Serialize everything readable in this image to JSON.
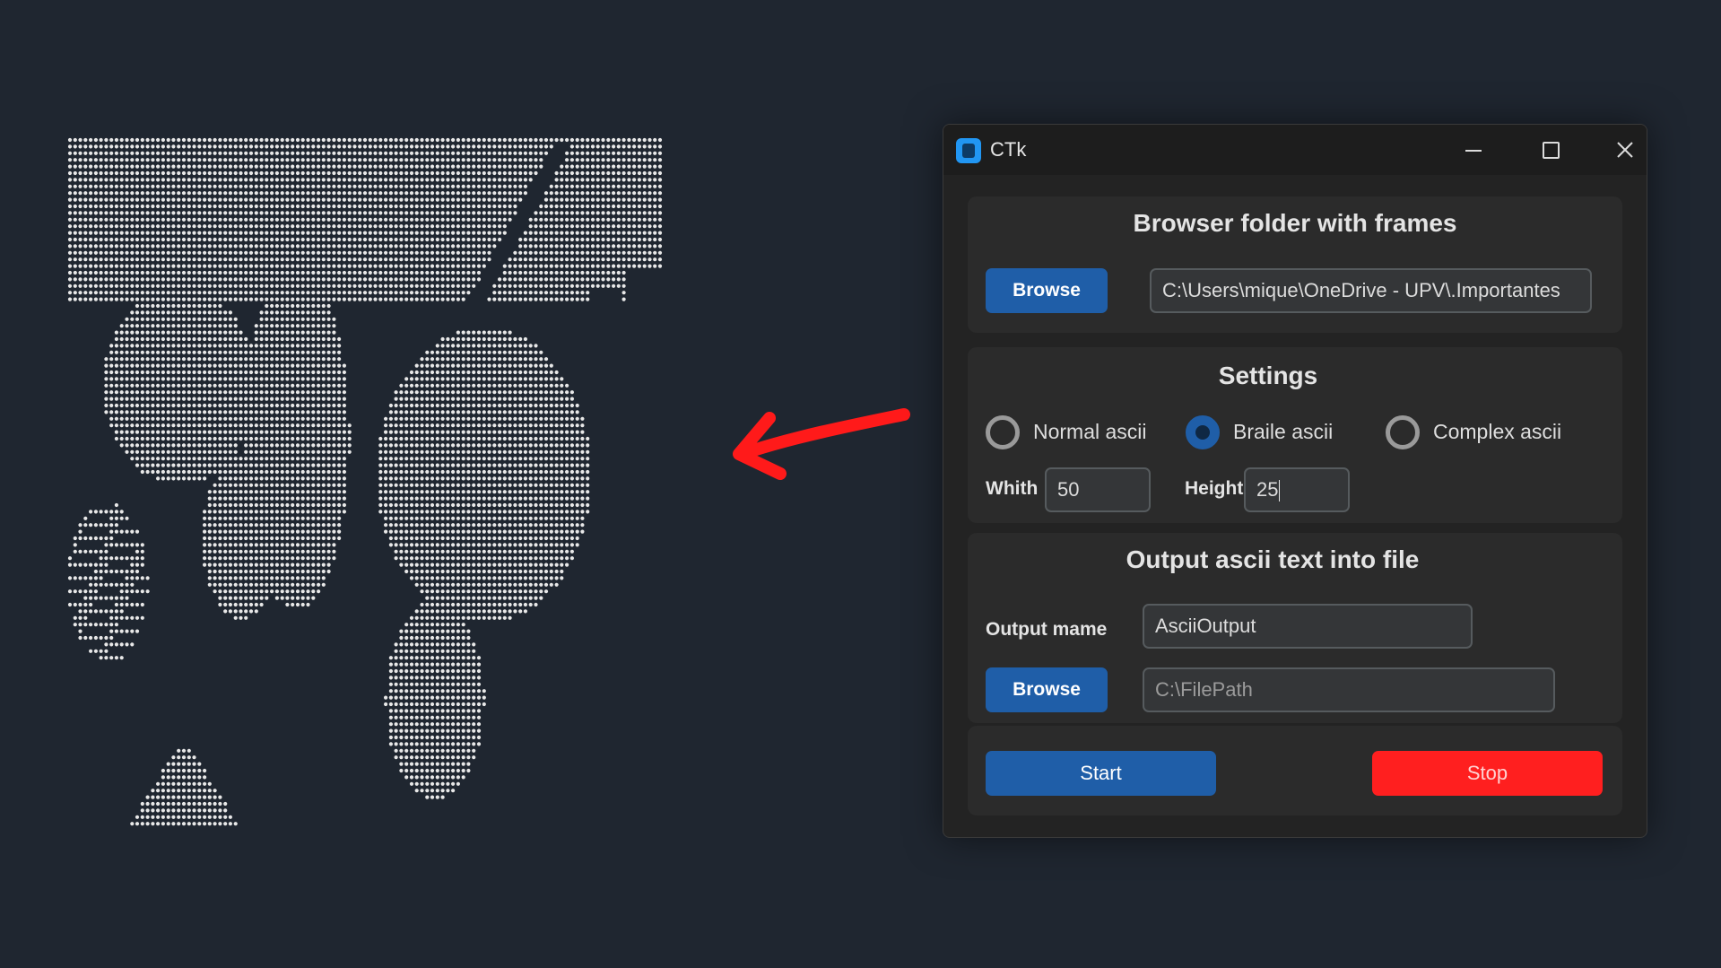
{
  "window": {
    "title": "CTk"
  },
  "folder_section": {
    "title": "Browser folder with frames",
    "browse_label": "Browse",
    "path_value": "C:\\Users\\mique\\OneDrive - UPV\\.Importantes"
  },
  "settings": {
    "title": "Settings",
    "radios": [
      {
        "label": "Normal ascii",
        "selected": false
      },
      {
        "label": "Braile ascii",
        "selected": true
      },
      {
        "label": "Complex ascii",
        "selected": false
      }
    ],
    "width_label": "Whith",
    "width_value": "50",
    "height_label": "Height",
    "height_value": "25"
  },
  "output_section": {
    "title": "Output ascii text into file",
    "name_label": "Output mame",
    "name_value": "AsciiOutput",
    "browse_label": "Browse",
    "path_placeholder": "C:\\FilePath"
  },
  "actions": {
    "start_label": "Start",
    "stop_label": "Stop"
  },
  "colors": {
    "accent": "#1f5ea8",
    "stop": "#ff1f1f",
    "arrow": "#ff1a1a",
    "background": "#1f2630",
    "braille_dots": "#e8e8e8"
  },
  "icons": [
    "app-icon",
    "minimize-icon",
    "maximize-icon",
    "close-icon",
    "arrow-left-icon"
  ]
}
